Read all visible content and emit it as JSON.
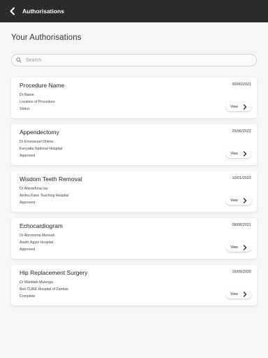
{
  "header": {
    "title": "Authorisations",
    "back_icon": "chevron-left-icon",
    "background": "#2b2b2b"
  },
  "page": {
    "title": "Your Authorisations"
  },
  "search": {
    "placeholder": "Search",
    "icon": "search-icon"
  },
  "cards": [
    {
      "title": "Procedure Name",
      "date": "00/00/2021",
      "doctor": "Dr Name",
      "location": "Location of Procedure",
      "status": "Status",
      "view_label": "View"
    },
    {
      "title": "Appendectomy",
      "date": "25/06/2022",
      "doctor": "Dr Emmanuel Otieno",
      "location": "Kenyatta National Hospital",
      "status": "Approved",
      "view_label": "View"
    },
    {
      "title": "Wisdom Teeth Removal",
      "date": "10/01/2022",
      "doctor": "Dr Afamefuna Isa",
      "location": "Aminu Kano Teaching Hospital",
      "status": "Approved",
      "view_label": "View"
    },
    {
      "title": "Echocardiogram",
      "date": "08/08/2021",
      "doctor": "Dr Abronoma Mensah",
      "location": "Asafo-Agyei Hospital",
      "status": "Approved",
      "view_label": "View"
    },
    {
      "title": "Hip Replacement Surgery",
      "date": "16/09/2020",
      "doctor": "Dr Matildah Mulenga",
      "location": "Beit CURE Hospital of Zambia",
      "status": "Complete",
      "view_label": "View"
    }
  ]
}
